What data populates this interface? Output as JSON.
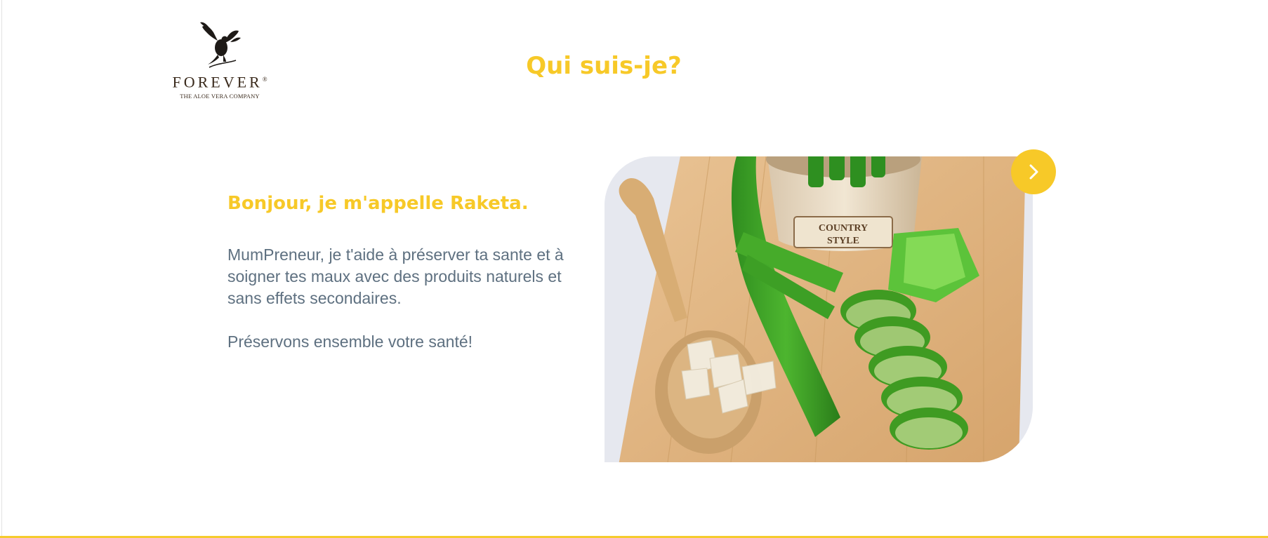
{
  "logo": {
    "brand": "FOREVER",
    "registered": "®",
    "tagline": "THE ALOE VERA COMPANY"
  },
  "page": {
    "title": "Qui suis-je?"
  },
  "intro": {
    "heading": "Bonjour, je m'appelle Raketa.",
    "text": "MumPreneur, je t'aide à préserver ta sante et à soigner tes maux avec des produits naturels et sans effets secondaires.",
    "tagline": "Préservons ensemble votre santé!"
  },
  "image": {
    "pot_label_line1": "COUNTRY",
    "pot_label_line2": "STYLE"
  },
  "navigation": {
    "next_icon": "chevron-right-icon"
  },
  "colors": {
    "accent": "#f7c928",
    "body_text": "#5e7080",
    "logo": "#3a2a1c"
  }
}
